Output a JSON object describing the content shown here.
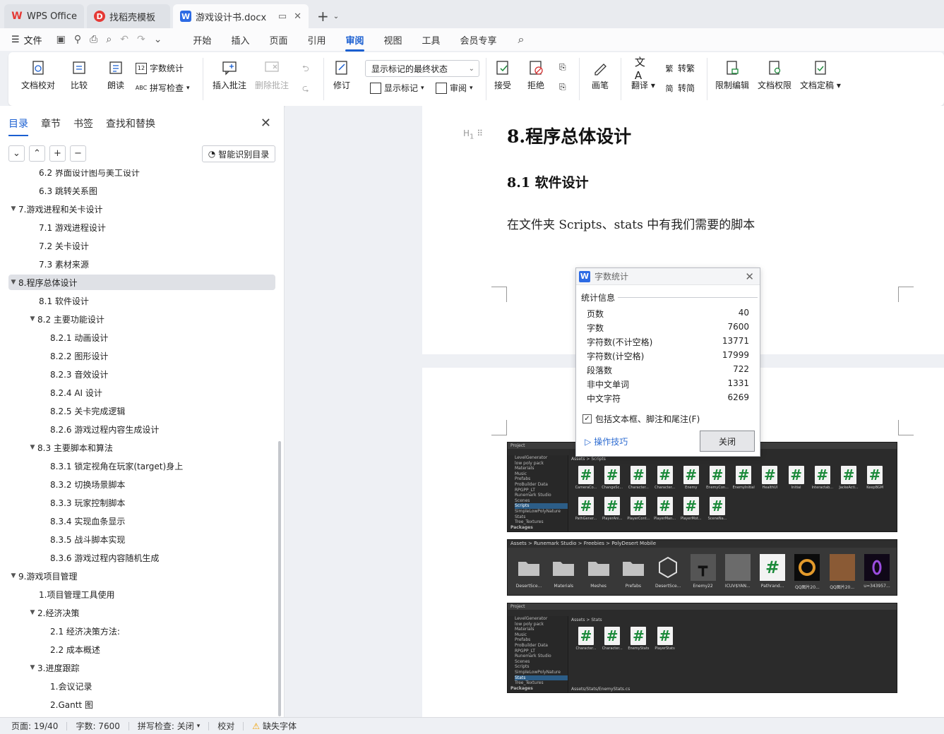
{
  "tabs": [
    {
      "label": "WPS Office"
    },
    {
      "label": "找稻壳模板"
    },
    {
      "label": "游戏设计书.docx"
    }
  ],
  "menu": {
    "file": "文件",
    "items": [
      "开始",
      "插入",
      "页面",
      "引用",
      "审阅",
      "视图",
      "工具",
      "会员专享"
    ],
    "active": "审阅"
  },
  "ribbon": {
    "doc_check": "文档校对",
    "compare": "比较",
    "read_aloud": "朗读",
    "word_count": "字数统计",
    "spell_check": "拼写检查",
    "insert_comment": "插入批注",
    "delete_comment": "删除批注",
    "revise": "修订",
    "markup_state": "显示标记的最终状态",
    "show_markup": "显示标记",
    "review": "审阅",
    "accept": "接受",
    "reject": "拒绝",
    "pen": "画笔",
    "translate": "翻译",
    "to_traditional": "转繁",
    "to_simplified": "转简",
    "restrict_edit": "限制编辑",
    "doc_permission": "文档权限",
    "doc_finalize": "文档定稿"
  },
  "nav": {
    "tabs": [
      "目录",
      "章节",
      "书签",
      "查找和替换"
    ],
    "smart_btn": "智能识别目录",
    "toc": [
      {
        "text": "6.2 界面设计图与美工设计",
        "level": 2,
        "arrow": ""
      },
      {
        "text": "6.3 跳转关系图",
        "level": 2,
        "arrow": ""
      },
      {
        "text": "7.游戏进程和关卡设计",
        "level": 1,
        "arrow": "▼"
      },
      {
        "text": "7.1 游戏进程设计",
        "level": 2,
        "arrow": ""
      },
      {
        "text": "7.2 关卡设计",
        "level": 2,
        "arrow": ""
      },
      {
        "text": "7.3 素材来源",
        "level": 2,
        "arrow": ""
      },
      {
        "text": "8.程序总体设计",
        "level": 1,
        "arrow": "▼",
        "selected": true
      },
      {
        "text": "8.1 软件设计",
        "level": 2,
        "arrow": ""
      },
      {
        "text": "8.2 主要功能设计",
        "level": 2,
        "arrow": "▼"
      },
      {
        "text": "8.2.1 动画设计",
        "level": 3,
        "arrow": ""
      },
      {
        "text": "8.2.2 图形设计",
        "level": 3,
        "arrow": ""
      },
      {
        "text": "8.2.3 音效设计",
        "level": 3,
        "arrow": ""
      },
      {
        "text": "8.2.4 AI 设计",
        "level": 3,
        "arrow": ""
      },
      {
        "text": "8.2.5 关卡完成逻辑",
        "level": 3,
        "arrow": ""
      },
      {
        "text": "8.2.6 游戏过程内容生成设计",
        "level": 3,
        "arrow": ""
      },
      {
        "text": "8.3 主要脚本和算法",
        "level": 2,
        "arrow": "▼"
      },
      {
        "text": "8.3.1 锁定视角在玩家(target)身上",
        "level": 3,
        "arrow": ""
      },
      {
        "text": "8.3.2 切换场景脚本",
        "level": 3,
        "arrow": ""
      },
      {
        "text": "8.3.3 玩家控制脚本",
        "level": 3,
        "arrow": ""
      },
      {
        "text": "8.3.4 实现血条显示",
        "level": 3,
        "arrow": ""
      },
      {
        "text": "8.3.5 战斗脚本实现",
        "level": 3,
        "arrow": ""
      },
      {
        "text": "8.3.6  游戏过程内容随机生成",
        "level": 3,
        "arrow": ""
      },
      {
        "text": "9.游戏项目管理",
        "level": 1,
        "arrow": "▼"
      },
      {
        "text": "1.项目管理工具使用",
        "level": 2,
        "arrow": ""
      },
      {
        "text": "2.经济决策",
        "level": 2,
        "arrow": "▼"
      },
      {
        "text": "2.1  经济决策方法:",
        "level": 3,
        "arrow": ""
      },
      {
        "text": "2.2  成本概述",
        "level": 3,
        "arrow": ""
      },
      {
        "text": "3.进度跟踪",
        "level": 2,
        "arrow": "▼"
      },
      {
        "text": "1.会议记录",
        "level": 3,
        "arrow": ""
      },
      {
        "text": "2.Gantt 图",
        "level": 3,
        "arrow": ""
      }
    ]
  },
  "doc": {
    "heading1": "8.程序总体设计",
    "heading2": "8.1 软件设计",
    "paragraph": "在文件夹 Scripts、stats 中有我们需要的脚本",
    "hmark": "H1"
  },
  "unity1": {
    "title": "Project",
    "crumb": "Assets > Scripts",
    "tree": [
      "LevelGenerator",
      "low poly pack",
      "Materials",
      "Music",
      "Prefabs",
      "ProBuilder Data",
      "RPGPP_LT",
      "Runemark Studio",
      "Scenes",
      "Scripts",
      "SimpleLowPolyNature",
      "Stats",
      "Tree_Textures",
      "Packages"
    ],
    "selected": "Scripts",
    "assets": [
      "CameraCo...",
      "ChangeSc...",
      "Character...",
      "Character...",
      "Enemy",
      "EnemyCon...",
      "EnemyInitial",
      "HealthUI",
      "Initial",
      "Interactab...",
      "JackeActi...",
      "KeepBGM",
      "PathGener...",
      "PlayerAni...",
      "PlayerCont...",
      "PlayerMan...",
      "PlayerMot...",
      "SceneNa..."
    ]
  },
  "unity2": {
    "crumb": "Assets > Runemark Studio > Freebies > PolyDesert Mobile",
    "assets": [
      "DesertSce...",
      "Materials",
      "Meshes",
      "Prefabs",
      "DesertSce...",
      "Enemy22",
      "ICUV$YAN...",
      "Pathrand...",
      "QQ图片20...",
      "QQ图片20...",
      "u=343957..."
    ]
  },
  "unity3": {
    "title": "Project",
    "crumb": "Assets > Stats",
    "tree": [
      "LevelGenerator",
      "low poly pack",
      "Materials",
      "Music",
      "Prefabs",
      "ProBuilder Data",
      "RPGPP_LT",
      "Runemark Studio",
      "Scenes",
      "Scripts",
      "SimpleLowPolyNature",
      "Stats",
      "Tree_Textures",
      "Packages"
    ],
    "selected": "Stats",
    "assets": [
      "Character...",
      "Character...",
      "EnemyStats",
      "PlayerStats"
    ],
    "footer": "Assets/Stats/EnemyStats.cs"
  },
  "dialog": {
    "title": "字数统计",
    "section": "统计信息",
    "stats": [
      {
        "label": "页数",
        "value": "40"
      },
      {
        "label": "字数",
        "value": "7600"
      },
      {
        "label": "字符数(不计空格)",
        "value": "13771"
      },
      {
        "label": "字符数(计空格)",
        "value": "17999"
      },
      {
        "label": "段落数",
        "value": "722"
      },
      {
        "label": "非中文单词",
        "value": "1331"
      },
      {
        "label": "中文字符",
        "value": "6269"
      }
    ],
    "checkbox": "包括文本框、脚注和尾注(F)",
    "tips": "操作技巧",
    "close": "关闭"
  },
  "status": {
    "page": "页面: 19/40",
    "words": "字数: 7600",
    "spell": "拼写检查: 关闭",
    "proof": "校对",
    "missing_font": "缺失字体"
  },
  "colors": {
    "accent": "#1a5fd1",
    "word_blue": "#2d6be4",
    "wps_red": "#e53935"
  }
}
